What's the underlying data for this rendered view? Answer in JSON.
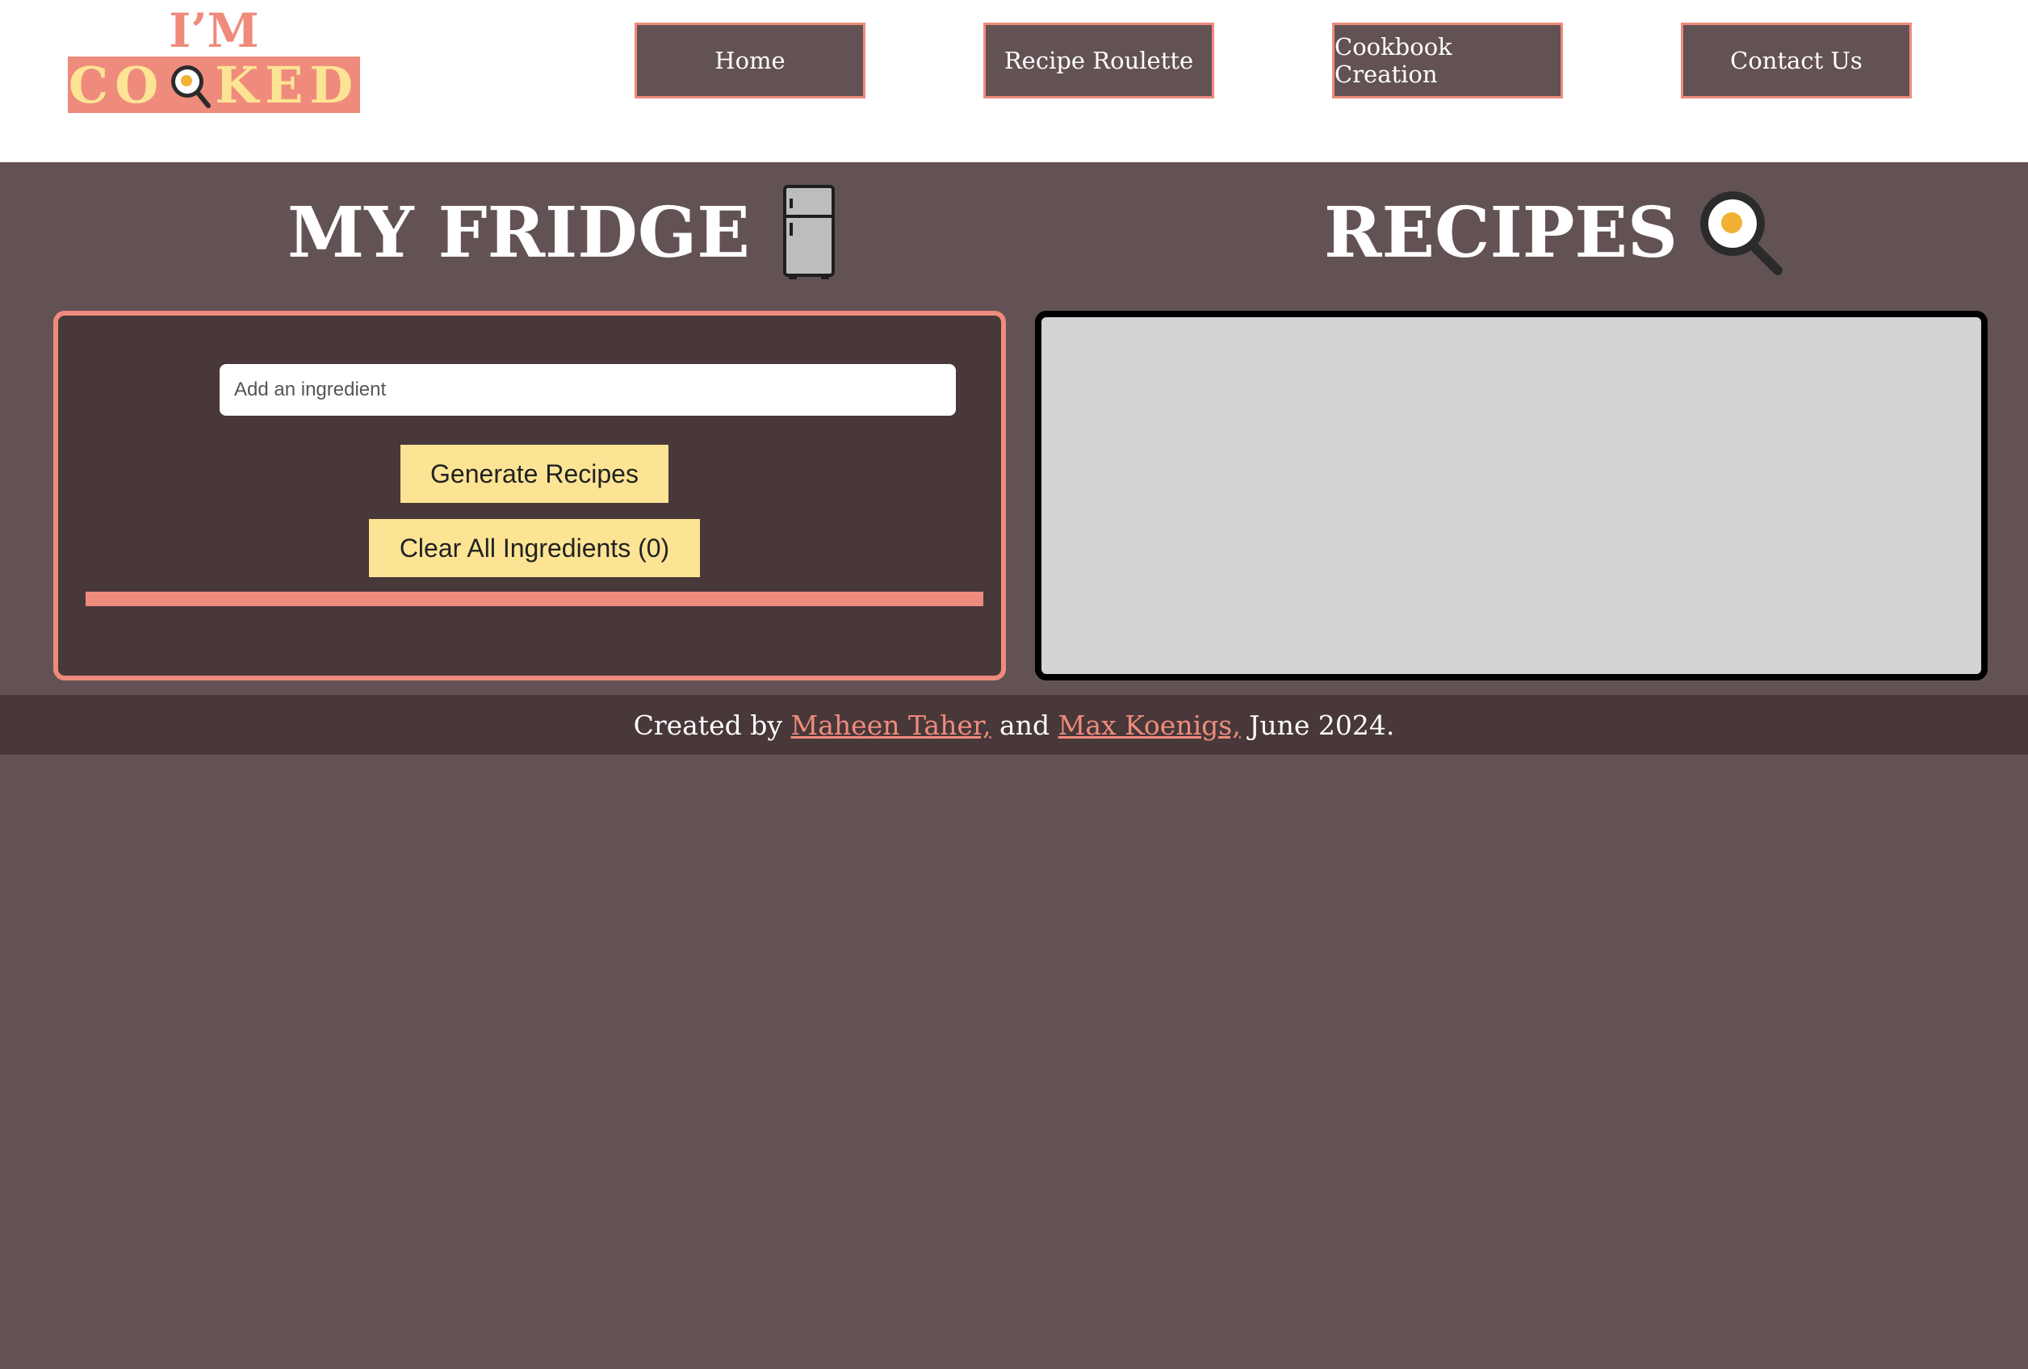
{
  "logo": {
    "top": "I’M",
    "word_left": "CO",
    "word_right": "KED"
  },
  "nav": {
    "items": [
      "Home",
      "Recipe Roulette",
      "Cookbook Creation",
      "Contact Us"
    ]
  },
  "fridge": {
    "title": "MY FRIDGE",
    "input_placeholder": "Add an ingredient",
    "input_value": "",
    "generate_label": "Generate Recipes",
    "clear_label": "Clear All Ingredients (0)"
  },
  "recipes": {
    "title": "RECIPES"
  },
  "footer": {
    "prefix": "Created by ",
    "author1": "Maheen Taher,",
    "middle": " and ",
    "author2": "Max Koenigs,",
    "suffix": " June 2024."
  },
  "icons": {
    "fridge": "fridge-icon",
    "pan": "frying-pan-egg-icon"
  },
  "colors": {
    "background": "#635254",
    "panel": "#48383a",
    "accent": "#ef8b7c",
    "button": "#fde494",
    "recipes_panel": "#d3d3d3"
  }
}
